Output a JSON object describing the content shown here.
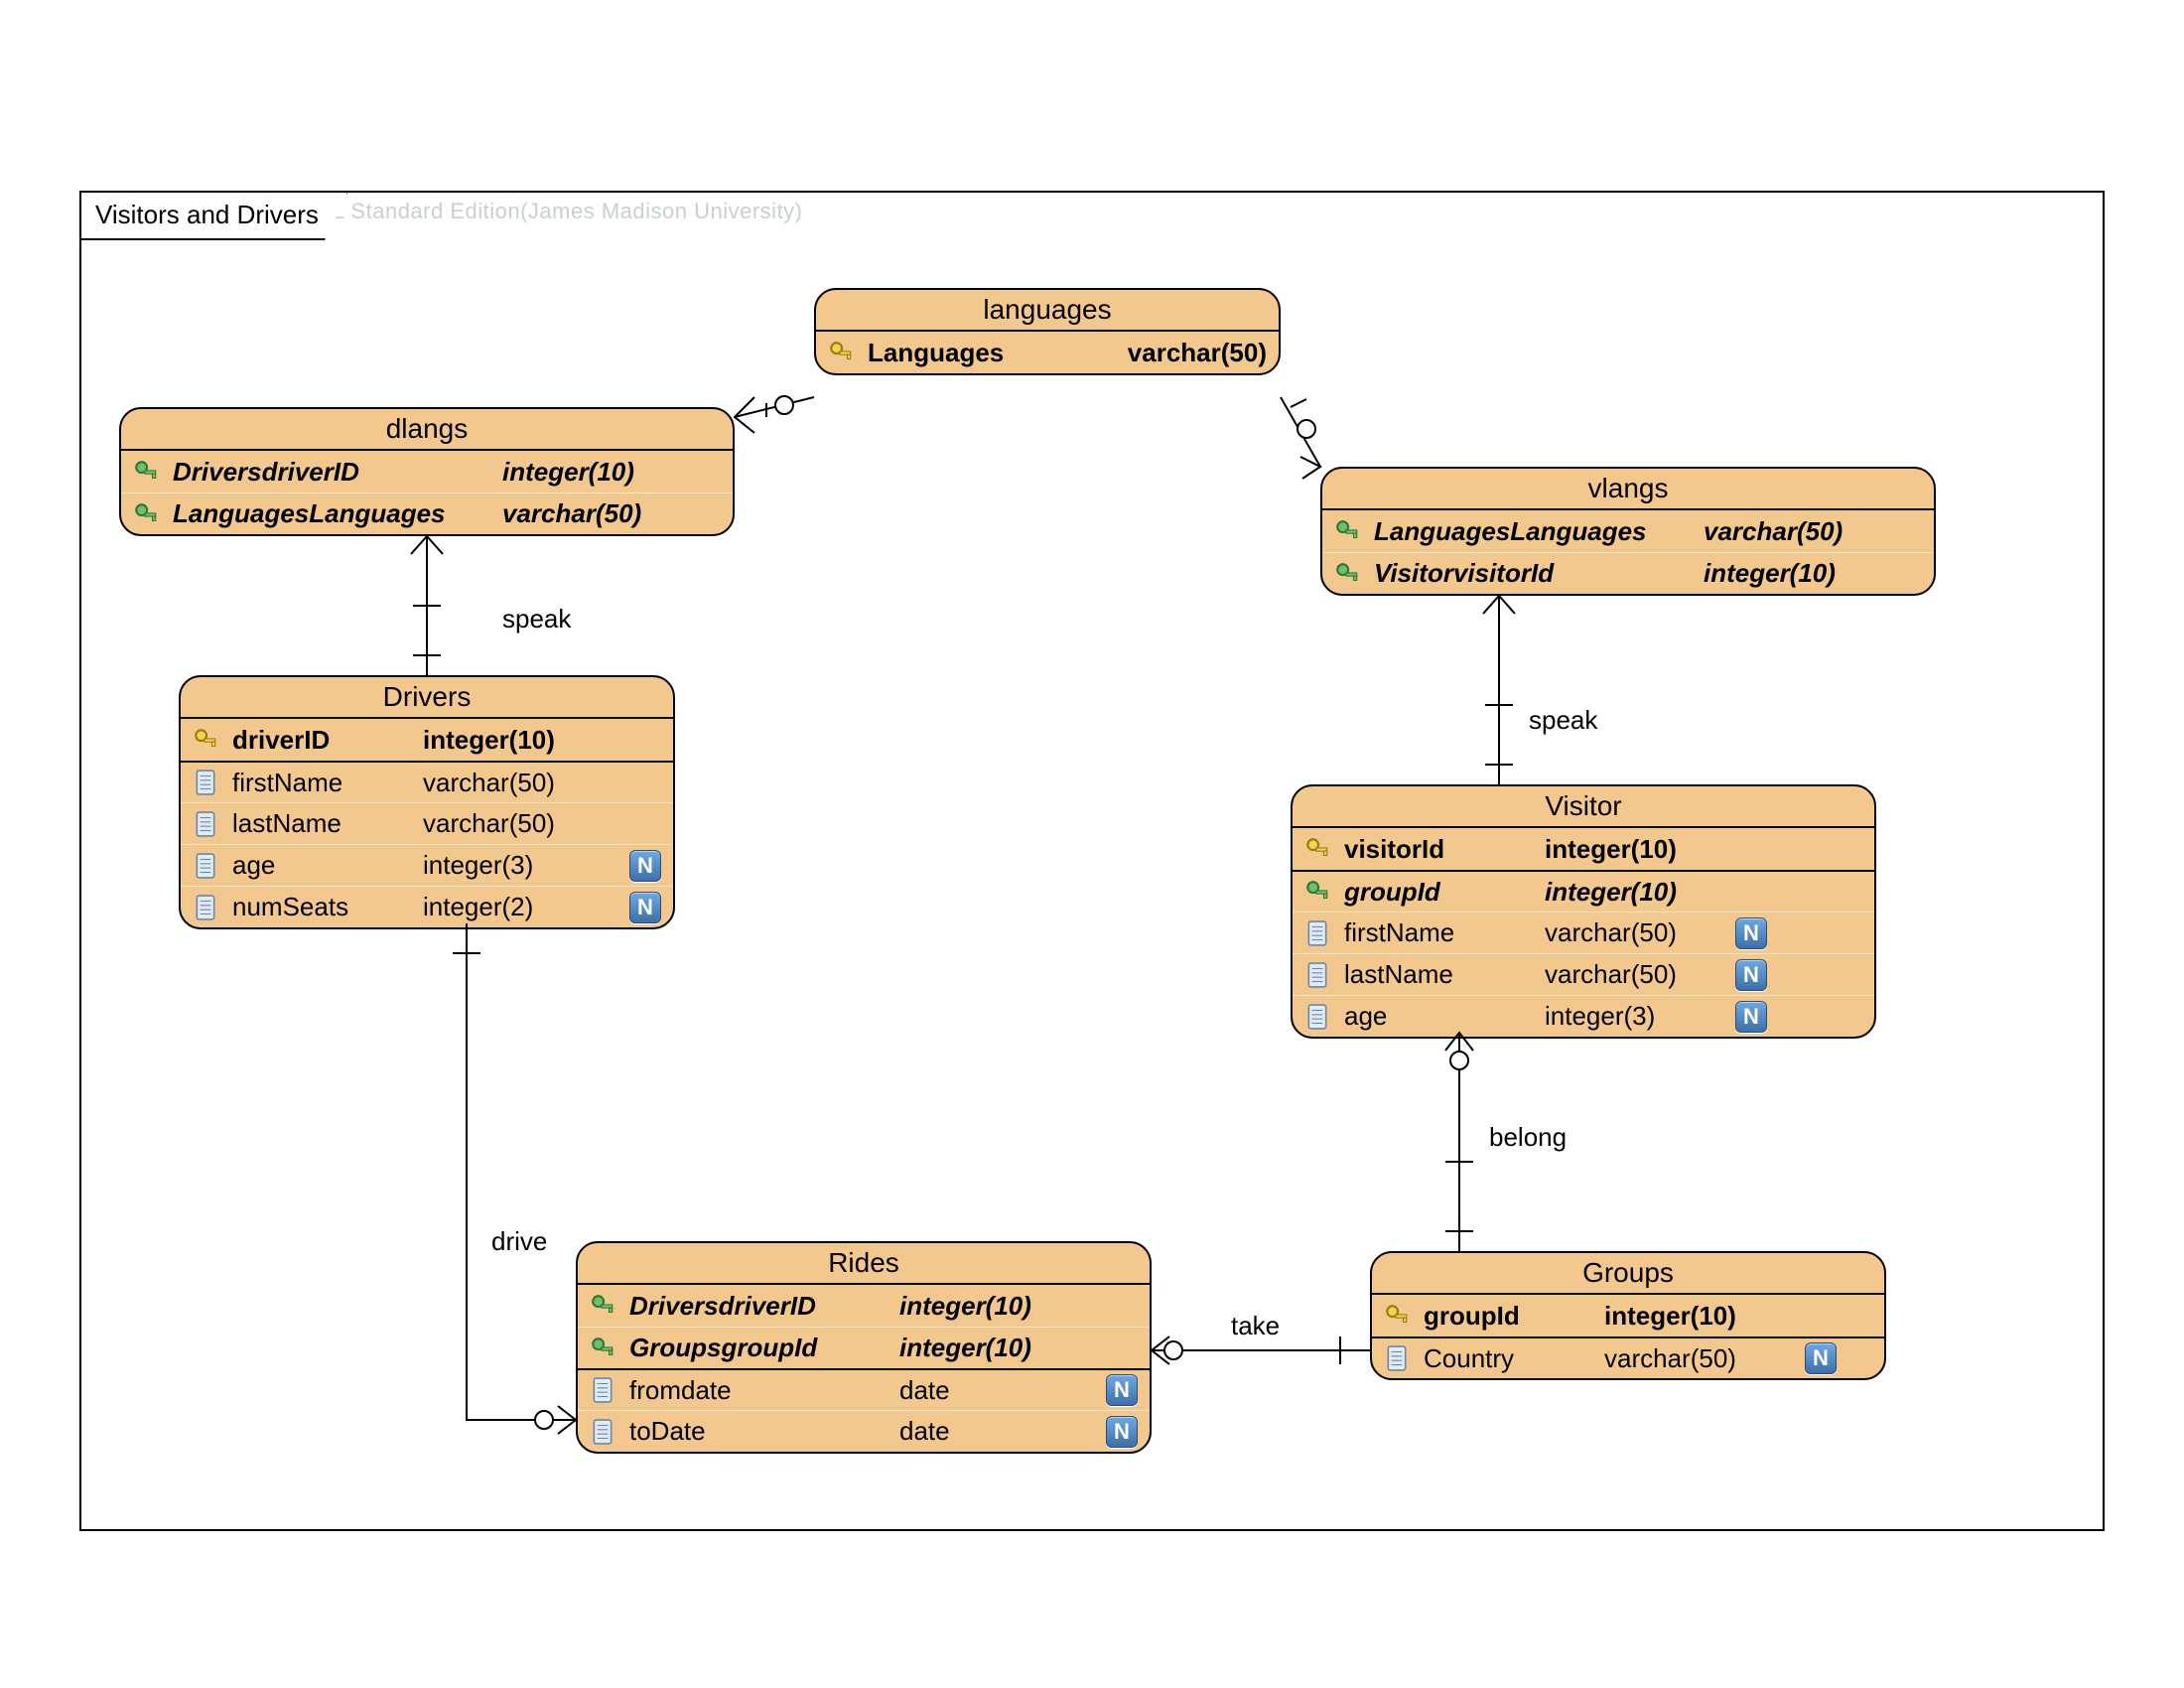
{
  "watermark": "Visual Paradigm for UML Standard Edition(James Madison University)",
  "frame_title": "Visitors and Drivers",
  "entities": {
    "languages": {
      "title": "languages",
      "rows": [
        {
          "kind": "pk",
          "name": "Languages",
          "type": "varchar(50)"
        }
      ]
    },
    "dlangs": {
      "title": "dlangs",
      "rows": [
        {
          "kind": "fk",
          "name": "DriversdriverID",
          "type": "integer(10)"
        },
        {
          "kind": "fk",
          "name": "LanguagesLanguages",
          "type": "varchar(50)"
        }
      ]
    },
    "vlangs": {
      "title": "vlangs",
      "rows": [
        {
          "kind": "fk",
          "name": "LanguagesLanguages",
          "type": "varchar(50)"
        },
        {
          "kind": "fk",
          "name": "VisitorvisitorId",
          "type": "integer(10)"
        }
      ]
    },
    "drivers": {
      "title": "Drivers",
      "rows": [
        {
          "kind": "pk",
          "name": "driverID",
          "type": "integer(10)"
        },
        {
          "kind": "col",
          "name": "firstName",
          "type": "varchar(50)",
          "sep": true
        },
        {
          "kind": "col",
          "name": "lastName",
          "type": "varchar(50)"
        },
        {
          "kind": "col",
          "name": "age",
          "type": "integer(3)",
          "nullable": true
        },
        {
          "kind": "col",
          "name": "numSeats",
          "type": "integer(2)",
          "nullable": true
        }
      ]
    },
    "visitor": {
      "title": "Visitor",
      "rows": [
        {
          "kind": "pk",
          "name": "visitorId",
          "type": "integer(10)"
        },
        {
          "kind": "fk",
          "name": "groupId",
          "type": "integer(10)",
          "sep": true
        },
        {
          "kind": "col",
          "name": "firstName",
          "type": "varchar(50)",
          "nullable": true
        },
        {
          "kind": "col",
          "name": "lastName",
          "type": "varchar(50)",
          "nullable": true
        },
        {
          "kind": "col",
          "name": "age",
          "type": "integer(3)",
          "nullable": true
        }
      ]
    },
    "rides": {
      "title": "Rides",
      "rows": [
        {
          "kind": "fk",
          "name": "DriversdriverID",
          "type": "integer(10)"
        },
        {
          "kind": "fk",
          "name": "GroupsgroupId",
          "type": "integer(10)"
        },
        {
          "kind": "col",
          "name": "fromdate",
          "type": "date",
          "nullable": true,
          "sep": true
        },
        {
          "kind": "col",
          "name": "toDate",
          "type": "date",
          "nullable": true
        }
      ]
    },
    "groups": {
      "title": "Groups",
      "rows": [
        {
          "kind": "pk",
          "name": "groupId",
          "type": "integer(10)"
        },
        {
          "kind": "col",
          "name": "Country",
          "type": "varchar(50)",
          "nullable": true,
          "sep": true
        }
      ]
    }
  },
  "relations": {
    "speak1": "speak",
    "speak2": "speak",
    "drive": "drive",
    "take": "take",
    "belong": "belong"
  },
  "nullable_badge": "N"
}
